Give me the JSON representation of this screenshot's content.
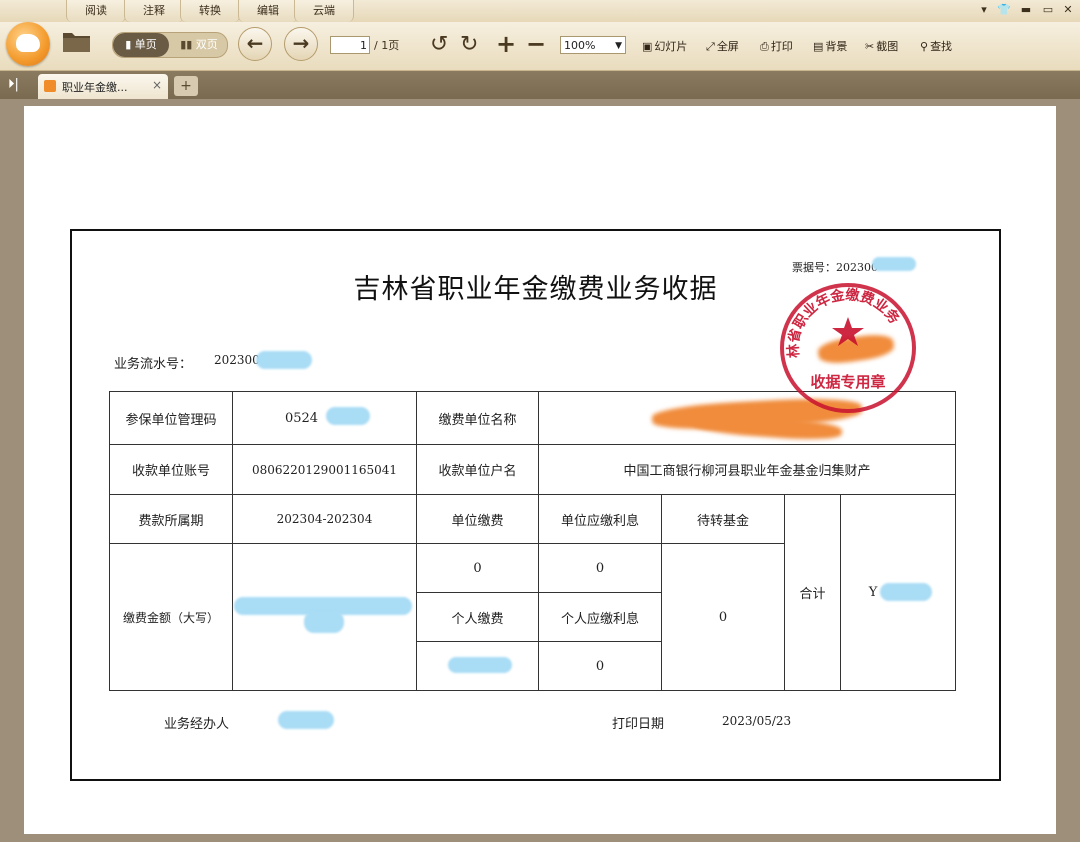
{
  "menu": {
    "tabs": [
      "阅读",
      "注释",
      "转换",
      "编辑",
      "云端"
    ]
  },
  "toolbar": {
    "single_page": "单页",
    "double_page": "双页",
    "page_current": "1",
    "page_total": "/ 1页",
    "zoom": "100%",
    "actions": {
      "slideshow": "幻灯片",
      "fullscreen": "全屏",
      "print": "打印",
      "background": "背景",
      "screenshot": "截图",
      "search": "查找"
    }
  },
  "tabs": {
    "doc_title": "职业年金缴...",
    "new_tab": "+"
  },
  "receipt": {
    "title": "吉林省职业年金缴费业务收据",
    "ticket_no": "票据号：202300",
    "serial_label": "业务流水号：",
    "serial_value": "202300",
    "rows": {
      "insured_unit_code_label": "参保单位管理码",
      "insured_unit_code_value": "0524",
      "payer_unit_name_label": "缴费单位名称",
      "receiver_account_label": "收款单位账号",
      "receiver_account_value": "0806220129001165041",
      "receiver_name_label": "收款单位户名",
      "receiver_name_value": "中国工商银行柳河县职业年金基金归集财产",
      "period_label": "费款所属期",
      "period_value": "202304-202304",
      "unit_payment_label": "单位缴费",
      "unit_interest_label": "单位应缴利息",
      "pending_fund_label": "待转基金",
      "amount_label": "缴费金额（大写）",
      "unit_payment_value": "0",
      "unit_interest_value": "0",
      "pending_fund_value": "0",
      "total_label": "合计",
      "total_value": "Y",
      "personal_payment_label": "个人缴费",
      "personal_interest_label": "个人应缴利息",
      "personal_interest_value": "0"
    },
    "handler_label": "业务经办人",
    "print_date_label": "打印日期",
    "print_date": "2023/05/23",
    "stamp_text": "林省职业年金缴费业务",
    "stamp_bottom": "收据专用章"
  },
  "colors": {
    "stamp_red": "#c8102e",
    "redaction_blue": "#a9dcf5",
    "redaction_orange": "#f08c3c"
  }
}
